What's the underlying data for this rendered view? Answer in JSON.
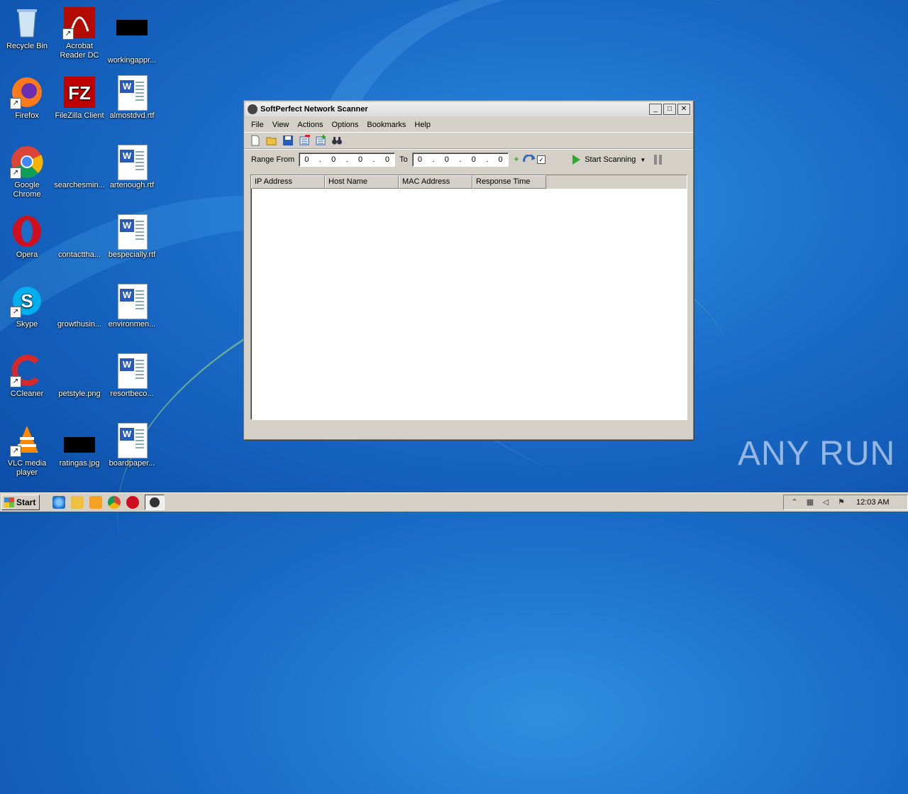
{
  "desktop": {
    "icons": [
      {
        "label": "Recycle Bin"
      },
      {
        "label": "Acrobat Reader DC"
      },
      {
        "label": "workingappr..."
      },
      {
        "label": "Firefox"
      },
      {
        "label": "FileZilla Client"
      },
      {
        "label": "almostdvd.rtf"
      },
      {
        "label": "Google Chrome"
      },
      {
        "label": "searchesmin..."
      },
      {
        "label": "artenough.rtf"
      },
      {
        "label": "Opera"
      },
      {
        "label": "contacttha..."
      },
      {
        "label": "bespecially.rtf"
      },
      {
        "label": "Skype"
      },
      {
        "label": "growthusin..."
      },
      {
        "label": "environmen..."
      },
      {
        "label": "CCleaner"
      },
      {
        "label": "petstyle.png"
      },
      {
        "label": "resortbeco..."
      },
      {
        "label": "VLC media player"
      },
      {
        "label": "ratingas.jpg"
      },
      {
        "label": "boardpaper..."
      }
    ]
  },
  "window": {
    "title": "SoftPerfect Network Scanner",
    "controls": {
      "minimize": "_",
      "maximize": "□",
      "close": "✕"
    },
    "menu": [
      "File",
      "View",
      "Actions",
      "Options",
      "Bookmarks",
      "Help"
    ],
    "range": {
      "from_label": "Range From",
      "from_octets": [
        "0",
        "0",
        "0",
        "0"
      ],
      "to_label": "To",
      "to_octets": [
        "0",
        "0",
        "0",
        "0"
      ]
    },
    "start_label": "Start Scanning",
    "columns": [
      "IP Address",
      "Host Name",
      "MAC Address",
      "Response Time"
    ]
  },
  "taskbar": {
    "start_label": "Start",
    "clock": "12:03 AM"
  },
  "watermark": "ANY RUN",
  "colors": {
    "accent_play": "#2ea82e",
    "desktop": "#1a6cc8"
  }
}
